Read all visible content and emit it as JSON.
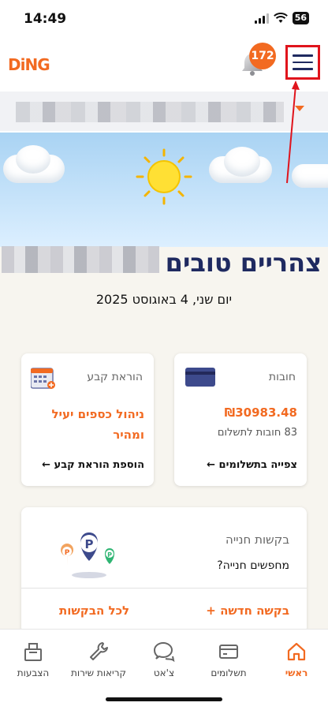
{
  "status": {
    "time": "14:49",
    "battery": "56"
  },
  "header": {
    "logo": "DiNG",
    "notification_count": "172"
  },
  "greeting": "צהריים טובים",
  "date": "יום שני, 4 באוגוסט 2025",
  "cards": {
    "debts": {
      "title": "חובות",
      "amount": "₪30983.48",
      "sub": "83 חובות לתשלום",
      "link": "צפייה בתשלומים ←"
    },
    "standing_order": {
      "title": "הוראת קבע",
      "headline": "ניהול כספים יעיל ומהיר",
      "link": "הוספת הוראת קבע ←"
    },
    "parking": {
      "title": "בקשות חנייה",
      "question": "מחפשים חנייה?",
      "new_request": "בקשה חדשה +",
      "all_requests": "לכל הבקשות"
    }
  },
  "nav": {
    "home": "ראשי",
    "payments": "תשלומים",
    "chat": "צ'אט",
    "service_calls": "קריאות שירות",
    "votes": "הצבעות"
  },
  "colors": {
    "accent": "#f26a21",
    "navy": "#1f2a60",
    "annotation": "#e0141c"
  },
  "icons": [
    "bell-icon",
    "menu-icon",
    "sun-icon",
    "cloud-icon",
    "credit-card-icon",
    "calendar-icon",
    "parking-pin-icon",
    "home-icon",
    "payment-card-icon",
    "chat-icon",
    "wrench-icon",
    "ballot-box-icon"
  ]
}
